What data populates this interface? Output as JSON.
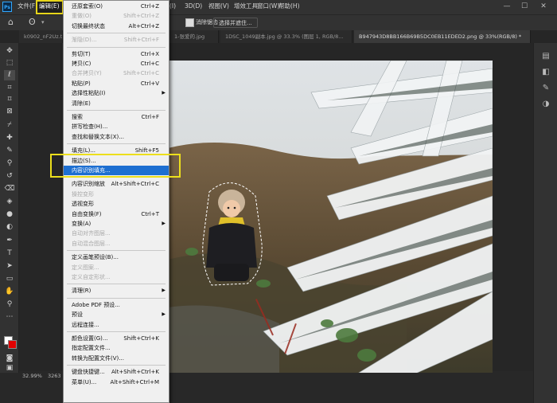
{
  "menubar": {
    "items": [
      {
        "label": "文件(F)"
      },
      {
        "label": "编辑(E)"
      },
      {
        "label": "(I)"
      },
      {
        "label": "3D(D)"
      },
      {
        "label": "视图(V)"
      },
      {
        "label": "增效工具"
      },
      {
        "label": "窗口(W)"
      },
      {
        "label": "帮助(H)"
      }
    ],
    "window_controls": [
      "—",
      "☐",
      "✕"
    ]
  },
  "optbar": {
    "clear_label": "消除锯齿",
    "select_subject_label": "选择并遮住..."
  },
  "tabs": [
    {
      "label": "k0902_nF2Uz.tt..."
    },
    {
      "label": "1-张爱的.jpg"
    },
    {
      "label": "1DSC_1049副本.jpg @ 33.3% (图层 1, RGB/8..."
    },
    {
      "label": "B947943D8BB166B69B5DC0EB11EDED2.png @ 33%(RGB/8) *"
    }
  ],
  "status": {
    "zoom": "32.99%",
    "size": "3263"
  },
  "edit_menu": {
    "items": [
      {
        "label": "还原套索(O)",
        "shortcut": "Ctrl+Z",
        "disabled": false
      },
      {
        "label": "重做(O)",
        "shortcut": "Shift+Ctrl+Z",
        "disabled": true
      },
      {
        "label": "切换最终状态",
        "shortcut": "Alt+Ctrl+Z",
        "disabled": false
      },
      {
        "sep": true
      },
      {
        "label": "渐隐(D)...",
        "shortcut": "Shift+Ctrl+F",
        "disabled": true
      },
      {
        "sep": true
      },
      {
        "label": "剪切(T)",
        "shortcut": "Ctrl+X",
        "disabled": false
      },
      {
        "label": "拷贝(C)",
        "shortcut": "Ctrl+C",
        "disabled": false
      },
      {
        "label": "合并拷贝(Y)",
        "shortcut": "Shift+Ctrl+C",
        "disabled": true
      },
      {
        "label": "粘贴(P)",
        "shortcut": "Ctrl+V",
        "disabled": false
      },
      {
        "label": "选择性粘贴(I)",
        "shortcut": "",
        "disabled": false,
        "submenu": true
      },
      {
        "label": "清除(E)",
        "shortcut": "",
        "disabled": false
      },
      {
        "sep": true
      },
      {
        "label": "搜索",
        "shortcut": "Ctrl+F",
        "disabled": false
      },
      {
        "label": "拼写检查(H)...",
        "shortcut": "",
        "disabled": false
      },
      {
        "label": "查找和替换文本(X)...",
        "shortcut": "",
        "disabled": false
      },
      {
        "sep": true
      },
      {
        "label": "填充(L)...",
        "shortcut": "Shift+F5",
        "disabled": false
      },
      {
        "label": "描边(S)...",
        "shortcut": "",
        "disabled": false
      },
      {
        "label": "内容识别填充...",
        "shortcut": "",
        "disabled": false,
        "highlighted": true
      },
      {
        "sep": true
      },
      {
        "label": "内容识别缩放",
        "shortcut": "Alt+Shift+Ctrl+C",
        "disabled": false
      },
      {
        "label": "操控变形",
        "shortcut": "",
        "disabled": true
      },
      {
        "label": "透视变形",
        "shortcut": "",
        "disabled": false
      },
      {
        "label": "自由变换(F)",
        "shortcut": "Ctrl+T",
        "disabled": false
      },
      {
        "label": "变换(A)",
        "shortcut": "",
        "disabled": false,
        "submenu": true
      },
      {
        "label": "自动对齐图层...",
        "shortcut": "",
        "disabled": true
      },
      {
        "label": "自动混合图层...",
        "shortcut": "",
        "disabled": true
      },
      {
        "sep": true
      },
      {
        "label": "定义画笔预设(B)...",
        "shortcut": "",
        "disabled": false
      },
      {
        "label": "定义图案...",
        "shortcut": "",
        "disabled": true
      },
      {
        "label": "定义自定形状...",
        "shortcut": "",
        "disabled": true
      },
      {
        "sep": true
      },
      {
        "label": "清理(R)",
        "shortcut": "",
        "disabled": false,
        "submenu": true
      },
      {
        "sep": true
      },
      {
        "label": "Adobe PDF 预设...",
        "shortcut": "",
        "disabled": false
      },
      {
        "label": "预设",
        "shortcut": "",
        "disabled": false,
        "submenu": true
      },
      {
        "label": "远程连接...",
        "shortcut": "",
        "disabled": false
      },
      {
        "sep": true
      },
      {
        "label": "颜色设置(G)...",
        "shortcut": "Shift+Ctrl+K",
        "disabled": false
      },
      {
        "label": "指定配置文件...",
        "shortcut": "",
        "disabled": false
      },
      {
        "label": "转换为配置文件(V)...",
        "shortcut": "",
        "disabled": false
      },
      {
        "sep": true
      },
      {
        "label": "键盘快捷键...",
        "shortcut": "Alt+Shift+Ctrl+K",
        "disabled": false
      },
      {
        "label": "菜单(U)...",
        "shortcut": "Alt+Shift+Ctrl+M",
        "disabled": false
      }
    ]
  },
  "colors": {
    "highlight": "#1d6fd1",
    "annotation": "#ecdf1c"
  },
  "icons": {
    "home": "home-icon",
    "lasso": "lasso-icon"
  }
}
